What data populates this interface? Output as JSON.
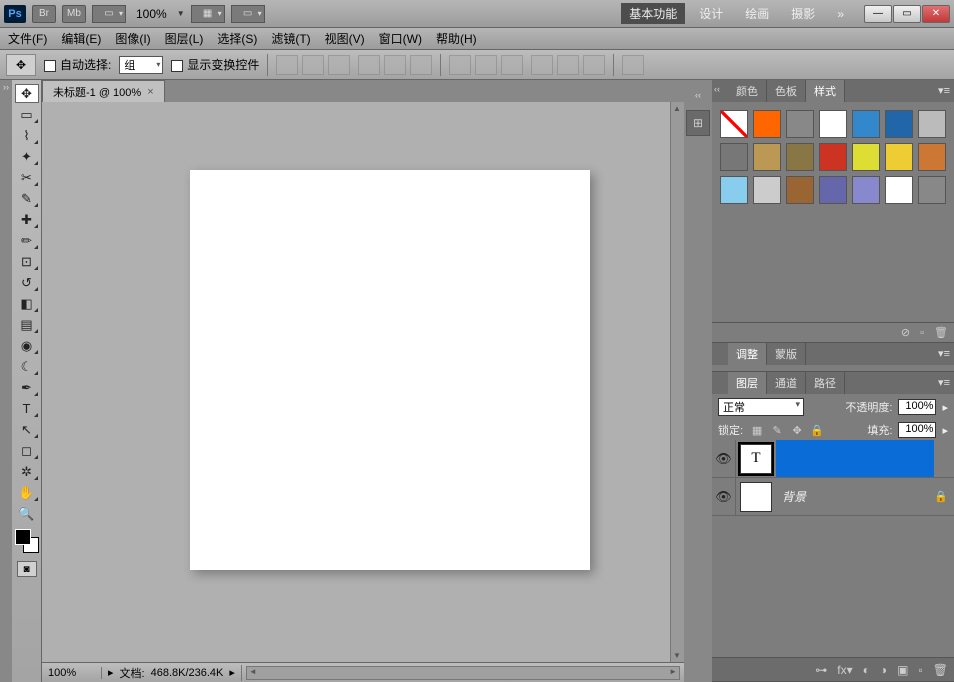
{
  "titlebar": {
    "zoom": "100%",
    "workspace_active": "基本功能",
    "workspaces": [
      "设计",
      "绘画",
      "摄影"
    ],
    "more": "»"
  },
  "menubar": {
    "file": "文件(F)",
    "edit": "编辑(E)",
    "image": "图像(I)",
    "layer": "图层(L)",
    "select": "选择(S)",
    "filter": "滤镜(T)",
    "view": "视图(V)",
    "window": "窗口(W)",
    "help": "帮助(H)"
  },
  "optbar": {
    "auto_select": "自动选择:",
    "group": "组",
    "show_transform": "显示变换控件"
  },
  "doc_tab": {
    "title": "未标题-1 @ 100%"
  },
  "statusbar": {
    "zoom": "100%",
    "doc_label": "文档:",
    "doc_size": "468.8K/236.4K"
  },
  "panels": {
    "styles": {
      "tab_color": "颜色",
      "tab_swatch": "色板",
      "tab_styles": "样式"
    },
    "adjust": {
      "tab_adjust": "调整",
      "tab_mask": "蒙版"
    },
    "layers": {
      "tab_layers": "图层",
      "tab_channels": "通道",
      "tab_paths": "路径",
      "blend_mode": "正常",
      "opacity_label": "不透明度:",
      "opacity_value": "100%",
      "lock_label": "锁定:",
      "fill_label": "填充:",
      "fill_value": "100%",
      "rows": [
        {
          "thumb": "T",
          "name": "",
          "locked": false
        },
        {
          "thumb": "",
          "name": "背景",
          "locked": true
        }
      ]
    }
  },
  "style_swatches": [
    "#ffffff",
    "#ff6600",
    "#888888",
    "#ffffff",
    "#3388cc",
    "#2266aa",
    "#bbbbbb",
    "#777777",
    "#bb9955",
    "#887744",
    "#cc3322",
    "#dddd33",
    "#eecc33",
    "#cc7733",
    "#88ccee",
    "#cccccc",
    "#996633",
    "#6666aa",
    "#8888cc",
    "#ffffff",
    "#888888"
  ],
  "style_none_diag": true
}
